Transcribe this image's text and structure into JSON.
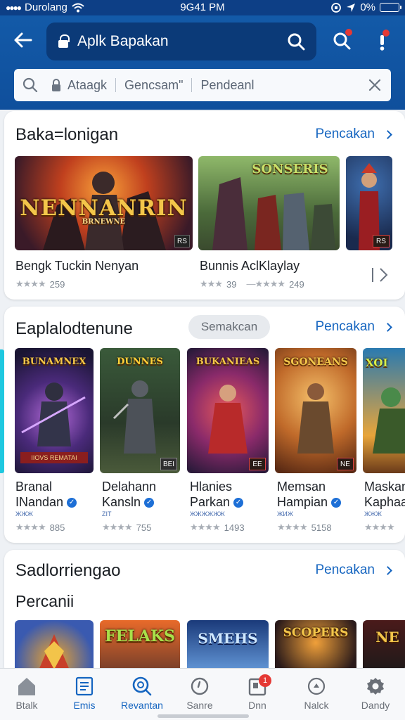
{
  "status": {
    "carrier": "Durolang",
    "time": "9G41 PM",
    "battery": "0%"
  },
  "header": {
    "title": "Aplk Bapakan"
  },
  "filter": {
    "seg1": "Ataagk",
    "seg2": "Gencsam\"",
    "seg3": "Pendeanl"
  },
  "section1": {
    "title": "Baka=lonigan",
    "link": "Pencakan",
    "games": [
      {
        "art": "NENNANRIN",
        "sub": "BRNEWNE",
        "name": "Bengk Tuckin Nenyan",
        "rating": "259",
        "badge": "RS"
      },
      {
        "art": "SONSERIS",
        "name": "Bunnis AclKlaylay",
        "rating": "39",
        "rating2": "249"
      },
      {
        "art": "",
        "badge": "RS"
      }
    ]
  },
  "section2": {
    "title": "Eaplalodtenune",
    "pill": "Semakcan",
    "link": "Pencakan",
    "games": [
      {
        "art": "BUNAMNEX",
        "line1": "Branal",
        "line2": "INandan",
        "tag": "ЖЖЖ",
        "rating": "885",
        "banner": "IIOVS REMATAI"
      },
      {
        "art": "DUNNES",
        "line1": "Delahann",
        "line2": "Kansln",
        "tag": "ZIT",
        "rating": "755",
        "badge": "BEI"
      },
      {
        "art": "BUKANIEAS",
        "line1": "Hlanies",
        "line2": "Parkan",
        "tag": "ЖЖЖЖЖЖ",
        "rating": "1493",
        "badge": "EE"
      },
      {
        "art": "SGONEANS",
        "line1": "Memsan",
        "line2": "Hampian",
        "tag": "ЖИЖ",
        "rating": "5158",
        "badge": "NE"
      },
      {
        "art": "XOI",
        "line1": "Maskan",
        "line2": "Kaphaa",
        "tag": "ЖЖЖ",
        "rating": ""
      }
    ]
  },
  "section3": {
    "title": "Sadlorriengao",
    "subtitle": "Percanii",
    "link": "Pencakan",
    "games": [
      {
        "art": ""
      },
      {
        "art": "FELAKS"
      },
      {
        "art": "SMEHS"
      },
      {
        "art": "SCOPERS"
      },
      {
        "art": "NE"
      }
    ]
  },
  "nav": [
    {
      "label": "Btalk",
      "icon": "home-icon"
    },
    {
      "label": "Emis",
      "icon": "grid-icon"
    },
    {
      "label": "Revantan",
      "icon": "search-icon"
    },
    {
      "label": "Sanre",
      "icon": "clock-icon"
    },
    {
      "label": "Dnn",
      "icon": "inbox-icon",
      "badge": "1"
    },
    {
      "label": "Nalck",
      "icon": "circle-icon"
    },
    {
      "label": "Dandy",
      "icon": "gear-icon"
    }
  ],
  "colors": {
    "accent": "#1565c0",
    "header": "#135aa8",
    "badge": "#e53935"
  }
}
